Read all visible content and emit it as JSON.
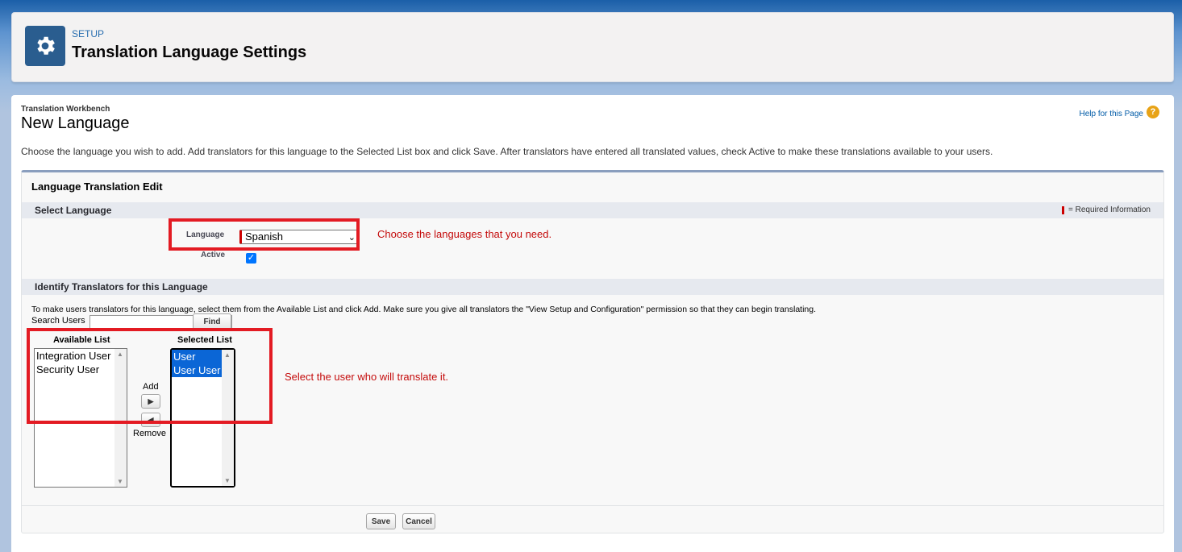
{
  "header": {
    "eyebrow": "SETUP",
    "title": "Translation Language Settings",
    "icon": "gear-icon"
  },
  "page": {
    "breadcrumb": "Translation Workbench",
    "title": "New Language",
    "help_link": "Help for this Page",
    "help_icon": "?",
    "intro": "Choose the language you wish to add. Add translators for this language to the Selected List box and click Save. After translators have entered all translated values, check Active to make these translations available to your users."
  },
  "edit": {
    "block_title": "Language Translation Edit",
    "section_language": "Select Language",
    "required_info": "= Required Information",
    "language_label": "Language",
    "language_value": "Spanish",
    "active_label": "Active",
    "active_checked": true,
    "note_language": "Choose the languages that you need.",
    "section_translators": "Identify Translators for this Language",
    "translators_desc": "To make users translators for this language, select them from the Available List and click Add. Make sure you give all translators the \"View Setup and Configuration\" permission so that they can begin translating.",
    "search_label": "Search Users",
    "search_value": "",
    "find_button": "Find",
    "available_header": "Available List",
    "available_items": [
      "Integration User",
      "Security User"
    ],
    "selected_header": "Selected List",
    "selected_items": [
      "User",
      "User User"
    ],
    "add_label": "Add",
    "remove_label": "Remove",
    "note_user": "Select the user who will translate it.",
    "save_button": "Save",
    "cancel_button": "Cancel"
  },
  "colors": {
    "accent_red": "#e31b23",
    "brand_blue": "#2a5d8f",
    "selection_blue": "#0b66d6"
  }
}
